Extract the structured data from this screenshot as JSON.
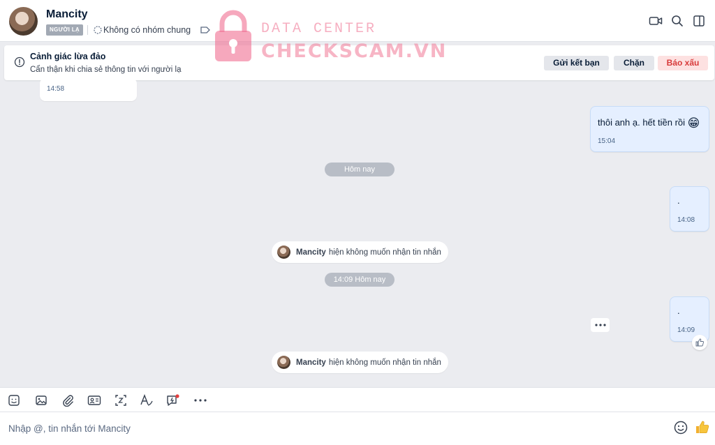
{
  "header": {
    "name": "Mancity",
    "stranger_badge": "NGƯỜI LẠ",
    "group_text": "Không có nhóm chung",
    "icons": [
      "video-call-icon",
      "search-icon",
      "sidebar-toggle-icon"
    ]
  },
  "watermark": {
    "line1": "DATA CENTER",
    "line2": "CHECKSCAM.VN"
  },
  "banner": {
    "title": "Cảnh giác lừa đảo",
    "description": "Cẩn thận khi chia sẻ thông tin với người lạ",
    "add_friend": "Gửi kết bạn",
    "block": "Chặn",
    "report": "Báo xấu"
  },
  "messages": [
    {
      "direction": "in",
      "text": "",
      "time": "14:58"
    },
    {
      "direction": "out",
      "text": "thôi anh ạ. hết tiền rồi",
      "emoji": "😁",
      "time": "15:04"
    },
    {
      "direction": "out",
      "text": ".",
      "time": "14:08"
    },
    {
      "direction": "out",
      "text": ".",
      "time": "14:09"
    }
  ],
  "dividers": [
    "Hôm nay",
    "14:09 Hôm nay"
  ],
  "system_notices": [
    {
      "name": "Mancity",
      "text": "hiện không muốn nhận tin nhắn"
    },
    {
      "name": "Mancity",
      "text": "hiện không muốn nhận tin nhắn"
    }
  ],
  "composer": {
    "placeholder": "Nhập @, tin nhắn tới Mancity",
    "toolbar_icons": [
      "sticker-icon",
      "image-icon",
      "attach-icon",
      "contact-card-icon",
      "screenshot-icon",
      "text-format-icon",
      "quick-message-icon",
      "more-icon"
    ]
  },
  "colors": {
    "accent": "#0068ff",
    "out_bubble": "#e5efff",
    "report_red": "#d83a3a",
    "background": "#ebecf0"
  }
}
